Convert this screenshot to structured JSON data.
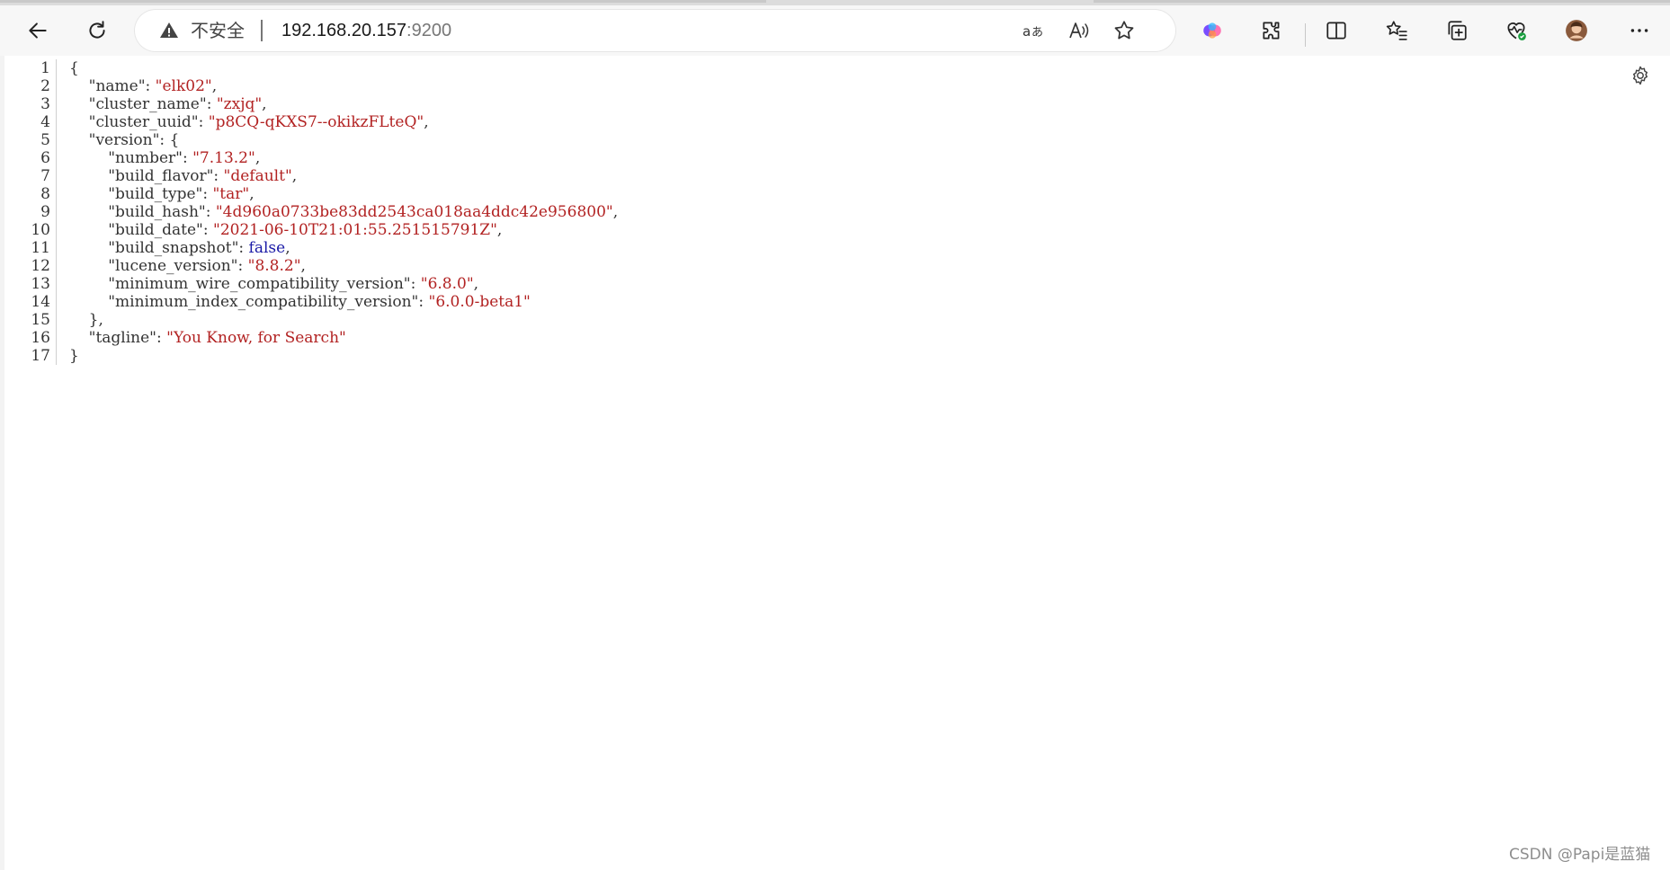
{
  "browser": {
    "security_label": "不安全",
    "url_host": "192.168.20.157",
    "url_port": ":9200",
    "icons": [
      "back-arrow-icon",
      "refresh-icon",
      "warning-icon",
      "translate-icon",
      "read-aloud-icon",
      "favorite-star-icon",
      "copilot-icon",
      "extensions-icon",
      "split-screen-icon",
      "favorites-icon",
      "collections-icon",
      "browser-essentials-icon",
      "profile-avatar",
      "more-icon"
    ]
  },
  "viewer": {
    "line_numbers": [
      "1",
      "2",
      "3",
      "4",
      "5",
      "6",
      "7",
      "8",
      "9",
      "10",
      "11",
      "12",
      "13",
      "14",
      "15",
      "16",
      "17"
    ],
    "lines": [
      {
        "indent": "",
        "parts": [
          {
            "t": "{",
            "c": "punc"
          }
        ]
      },
      {
        "indent": "    ",
        "parts": [
          {
            "t": "\"name\"",
            "c": "key"
          },
          {
            "t": ": ",
            "c": "punc"
          },
          {
            "t": "\"elk02\"",
            "c": "str"
          },
          {
            "t": ",",
            "c": "punc"
          }
        ]
      },
      {
        "indent": "    ",
        "parts": [
          {
            "t": "\"cluster_name\"",
            "c": "key"
          },
          {
            "t": ": ",
            "c": "punc"
          },
          {
            "t": "\"zxjq\"",
            "c": "str"
          },
          {
            "t": ",",
            "c": "punc"
          }
        ]
      },
      {
        "indent": "    ",
        "parts": [
          {
            "t": "\"cluster_uuid\"",
            "c": "key"
          },
          {
            "t": ": ",
            "c": "punc"
          },
          {
            "t": "\"p8CQ-qKXS7--okikzFLteQ\"",
            "c": "str"
          },
          {
            "t": ",",
            "c": "punc"
          }
        ]
      },
      {
        "indent": "    ",
        "parts": [
          {
            "t": "\"version\"",
            "c": "key"
          },
          {
            "t": ": {",
            "c": "punc"
          }
        ]
      },
      {
        "indent": "        ",
        "parts": [
          {
            "t": "\"number\"",
            "c": "key"
          },
          {
            "t": ": ",
            "c": "punc"
          },
          {
            "t": "\"7.13.2\"",
            "c": "str"
          },
          {
            "t": ",",
            "c": "punc"
          }
        ]
      },
      {
        "indent": "        ",
        "parts": [
          {
            "t": "\"build_flavor\"",
            "c": "key"
          },
          {
            "t": ": ",
            "c": "punc"
          },
          {
            "t": "\"default\"",
            "c": "str"
          },
          {
            "t": ",",
            "c": "punc"
          }
        ]
      },
      {
        "indent": "        ",
        "parts": [
          {
            "t": "\"build_type\"",
            "c": "key"
          },
          {
            "t": ": ",
            "c": "punc"
          },
          {
            "t": "\"tar\"",
            "c": "str"
          },
          {
            "t": ",",
            "c": "punc"
          }
        ]
      },
      {
        "indent": "        ",
        "parts": [
          {
            "t": "\"build_hash\"",
            "c": "key"
          },
          {
            "t": ": ",
            "c": "punc"
          },
          {
            "t": "\"4d960a0733be83dd2543ca018aa4ddc42e956800\"",
            "c": "str"
          },
          {
            "t": ",",
            "c": "punc"
          }
        ]
      },
      {
        "indent": "        ",
        "parts": [
          {
            "t": "\"build_date\"",
            "c": "key"
          },
          {
            "t": ": ",
            "c": "punc"
          },
          {
            "t": "\"2021-06-10T21:01:55.251515791Z\"",
            "c": "str"
          },
          {
            "t": ",",
            "c": "punc"
          }
        ]
      },
      {
        "indent": "        ",
        "parts": [
          {
            "t": "\"build_snapshot\"",
            "c": "key"
          },
          {
            "t": ": ",
            "c": "punc"
          },
          {
            "t": "false",
            "c": "bool"
          },
          {
            "t": ",",
            "c": "punc"
          }
        ]
      },
      {
        "indent": "        ",
        "parts": [
          {
            "t": "\"lucene_version\"",
            "c": "key"
          },
          {
            "t": ": ",
            "c": "punc"
          },
          {
            "t": "\"8.8.2\"",
            "c": "str"
          },
          {
            "t": ",",
            "c": "punc"
          }
        ]
      },
      {
        "indent": "        ",
        "parts": [
          {
            "t": "\"minimum_wire_compatibility_version\"",
            "c": "key"
          },
          {
            "t": ": ",
            "c": "punc"
          },
          {
            "t": "\"6.8.0\"",
            "c": "str"
          },
          {
            "t": ",",
            "c": "punc"
          }
        ]
      },
      {
        "indent": "        ",
        "parts": [
          {
            "t": "\"minimum_index_compatibility_version\"",
            "c": "key"
          },
          {
            "t": ": ",
            "c": "punc"
          },
          {
            "t": "\"6.0.0-beta1\"",
            "c": "str"
          }
        ]
      },
      {
        "indent": "    ",
        "parts": [
          {
            "t": "},",
            "c": "punc"
          }
        ]
      },
      {
        "indent": "    ",
        "parts": [
          {
            "t": "\"tagline\"",
            "c": "key"
          },
          {
            "t": ": ",
            "c": "punc"
          },
          {
            "t": "\"You Know, for Search\"",
            "c": "str"
          }
        ]
      },
      {
        "indent": "",
        "parts": [
          {
            "t": "}",
            "c": "punc"
          }
        ]
      }
    ]
  },
  "watermark": "CSDN @Papi是蓝猫",
  "colors": {
    "string": "#b22222",
    "boolean": "#1a1aa6",
    "text": "#333333",
    "background": "#ffffff",
    "chrome": "#f7f7f7"
  }
}
